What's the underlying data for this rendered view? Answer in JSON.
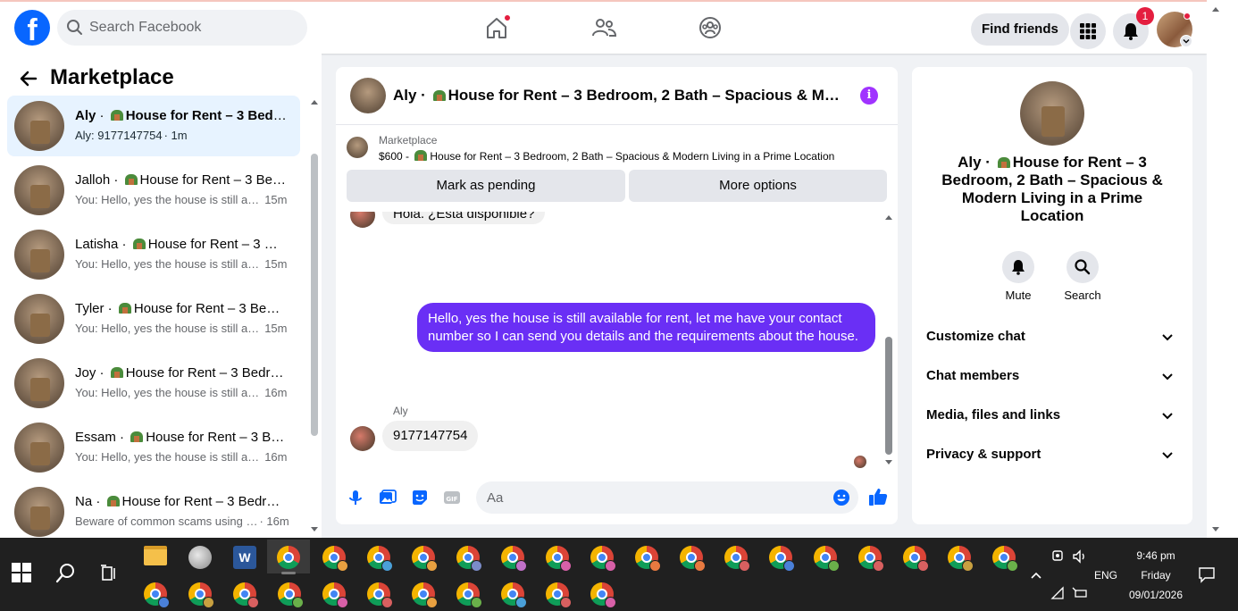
{
  "topbar": {
    "search_placeholder": "Search Facebook",
    "find_friends": "Find friends",
    "notification_count": "1",
    "accent": "#0866ff"
  },
  "sidebar": {
    "title": "Marketplace",
    "conversations": [
      {
        "name": "Aly",
        "listing": "House for Rent – 3 Bedr…",
        "preview": "Aly: 9177147754",
        "time": "· 1m",
        "active": true
      },
      {
        "name": "Jalloh",
        "listing": "House for Rent – 3 Be…",
        "preview": "You: Hello, yes the house is still a…",
        "time": "15m"
      },
      {
        "name": "Latisha",
        "listing": "House for Rent – 3 …",
        "preview": "You: Hello, yes the house is still a…",
        "time": "15m"
      },
      {
        "name": "Tyler",
        "listing": "House for Rent – 3 Be…",
        "preview": "You: Hello, yes the house is still a…",
        "time": "15m"
      },
      {
        "name": "Joy",
        "listing": "House for Rent – 3 Bedr…",
        "preview": "You: Hello, yes the house is still a…",
        "time": "16m"
      },
      {
        "name": "Essam",
        "listing": "House for Rent – 3 B…",
        "preview": "You: Hello, yes the house is still a…",
        "time": "16m"
      },
      {
        "name": "Na",
        "listing": "House for Rent – 3 Bedr…",
        "preview": "Beware of common scams using …",
        "time": "· 16m"
      }
    ]
  },
  "chat": {
    "title": "Aly · 🏡 House for Rent – 3 Bedroom, 2 Bath – Spacious & Mode…",
    "title_name": "Aly ·",
    "title_rest": "House for Rent – 3 Bedroom, 2 Bath – Spacious & Mode…",
    "marketplace_label": "Marketplace",
    "listing_price": "$600 -",
    "listing_title": "House for Rent – 3 Bedroom, 2 Bath – Spacious & Modern Living in a Prime Location",
    "mark_pending": "Mark as pending",
    "more_options": "More options",
    "partial_message": "Hola. ¿Está disponible?",
    "outgoing_message": "Hello, yes the house is still available for rent, let me have your contact number so I can send you details and the requirements about the house.",
    "sender_name": "Aly",
    "incoming_message": "9177147754",
    "composer_placeholder": "Aa",
    "outgoing_color": "#6a2ff5"
  },
  "info_panel": {
    "name": "Aly · 🏡 House for Rent – 3 Bedroom, 2 Bath – Spacious & Modern Living in a Prime Location",
    "name_prefix": "Aly ·",
    "name_rest": "House for Rent – 3 Bedroom, 2 Bath – Spacious & Modern Living in a Prime Location",
    "actions": {
      "mute": "Mute",
      "search": "Search"
    },
    "sections": [
      "Customize chat",
      "Chat members",
      "Media, files and links",
      "Privacy & support"
    ]
  },
  "taskbar": {
    "language": "ENG",
    "time": "9:46 pm",
    "day": "Friday",
    "date": "09/01/2026"
  }
}
